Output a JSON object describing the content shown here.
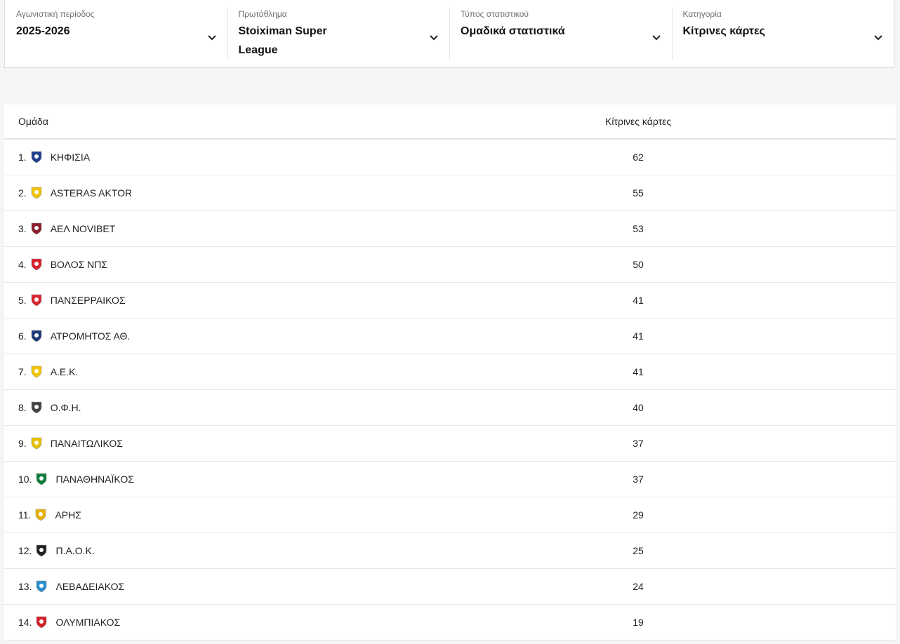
{
  "filters": [
    {
      "label": "Αγωνιστική περίοδος",
      "value": "2025-2026"
    },
    {
      "label": "Πρωτάθλημα",
      "value": "Stoiximan Super League"
    },
    {
      "label": "Τύπος στατιστικού",
      "value": "Ομαδικά στατιστικά"
    },
    {
      "label": "Κατηγορία",
      "value": "Κίτρινες κάρτες"
    }
  ],
  "table": {
    "headers": {
      "team": "Ομάδα",
      "value": "Κίτρινες κάρτες"
    },
    "rows": [
      {
        "pos": "1.",
        "team": "ΚΗΦΙΣΙΑ",
        "value": "62",
        "logo": "kifisia-logo",
        "color": "#1f3f8f"
      },
      {
        "pos": "2.",
        "team": "ASTERAS AKTOR",
        "value": "55",
        "logo": "asteras-logo",
        "color": "#f2c200"
      },
      {
        "pos": "3.",
        "team": "ΑΕΛ NOVIBET",
        "value": "53",
        "logo": "ael-logo",
        "color": "#8b1d2c"
      },
      {
        "pos": "4.",
        "team": "ΒΟΛΟΣ ΝΠΣ",
        "value": "50",
        "logo": "volos-logo",
        "color": "#d61f2b"
      },
      {
        "pos": "5.",
        "team": "ΠΑΝΣΕΡΡΑΙΚΟΣ",
        "value": "41",
        "logo": "panserraikos-logo",
        "color": "#d7262f"
      },
      {
        "pos": "6.",
        "team": "ΑΤΡΟΜΗΤΟΣ ΑΘ.",
        "value": "41",
        "logo": "atromitos-logo",
        "color": "#1d3a78"
      },
      {
        "pos": "7.",
        "team": "Α.Ε.Κ.",
        "value": "41",
        "logo": "aek-logo",
        "color": "#f2c500"
      },
      {
        "pos": "8.",
        "team": "Ο.Φ.Η.",
        "value": "40",
        "logo": "ofi-logo",
        "color": "#444444"
      },
      {
        "pos": "9.",
        "team": "ΠΑΝΑΙΤΩΛΙΚΟΣ",
        "value": "37",
        "logo": "panaitolikos-logo",
        "color": "#e6c200"
      },
      {
        "pos": "10.",
        "team": "ΠΑΝΑΘΗΝΑΪΚΟΣ",
        "value": "37",
        "logo": "panathinaikos-logo",
        "color": "#0d7a3b"
      },
      {
        "pos": "11.",
        "team": "ΑΡΗΣ",
        "value": "29",
        "logo": "aris-logo",
        "color": "#e8b400"
      },
      {
        "pos": "12.",
        "team": "Π.Α.Ο.Κ.",
        "value": "25",
        "logo": "paok-logo",
        "color": "#222222"
      },
      {
        "pos": "13.",
        "team": "ΛΕΒΑΔΕΙΑΚΟΣ",
        "value": "24",
        "logo": "levadiakos-logo",
        "color": "#2a8fd0"
      },
      {
        "pos": "14.",
        "team": "ΟΛΥΜΠΙΑΚΟΣ",
        "value": "19",
        "logo": "olympiakos-logo",
        "color": "#d4202c"
      }
    ]
  }
}
